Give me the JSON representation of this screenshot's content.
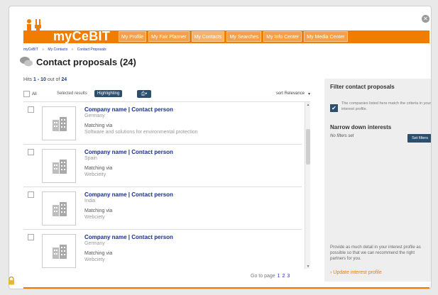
{
  "header": {
    "logo_text": "myCeBIT",
    "nav": [
      "My Profile",
      "My Fair Planner",
      "My Contacts",
      "My Searches",
      "My Info Center",
      "My Media Center"
    ],
    "active_nav": "My Contacts"
  },
  "breadcrumb": [
    "myCeBIT",
    "»",
    "My Contacts",
    "»",
    "Contact Proposals"
  ],
  "page": {
    "title": "Contact proposals (24)"
  },
  "hits": {
    "prefix": "Hits",
    "range": "1 - 10",
    "mid": "out of",
    "total": "24"
  },
  "toolbar": {
    "all_label": "All",
    "selected_label": "Selected results",
    "highlighting_label": "Highlighting",
    "print_label": "⎙▾",
    "sort_label": "sort Relevance",
    "sort_arrow": "▾"
  },
  "results": [
    {
      "title": "Company name | Contact person",
      "country": "Germany",
      "matching_label": "Matching via",
      "matching_value": "Software and solutions for environmental protection"
    },
    {
      "title": "Company name | Contact person",
      "country": "Spain",
      "matching_label": "Matching via",
      "matching_value": "Webcieity"
    },
    {
      "title": "Company name | Contact person",
      "country": "India",
      "matching_label": "Matching via",
      "matching_value": "Webciety"
    },
    {
      "title": "Company name | Contact person",
      "country": "Germany",
      "matching_label": "Matching via",
      "matching_value": "Webciety"
    }
  ],
  "pagination": {
    "label": "Go to page",
    "pages": [
      "1",
      "2",
      "3"
    ]
  },
  "filter": {
    "title": "Filter contact proposals",
    "check_glyph": "✔",
    "match_desc": "The companies listed here match the criteria in your interest profile.",
    "narrow_title": "Narrow down interests",
    "no_filters": "No filters set",
    "set_filters_label": "Set filters",
    "provide_text": "Provide as much detail in your interest profile as possible so that we can recommend the right partners for you.",
    "update_link": "› Update interest profile"
  },
  "colors": {
    "accent": "#f07d00",
    "navy": "#2d4f6e",
    "link": "#1a2f8a"
  },
  "icons": [
    "close-icon",
    "chat-bubbles-icon",
    "building-icon",
    "print-icon",
    "checkmark-icon",
    "lock-icon"
  ]
}
